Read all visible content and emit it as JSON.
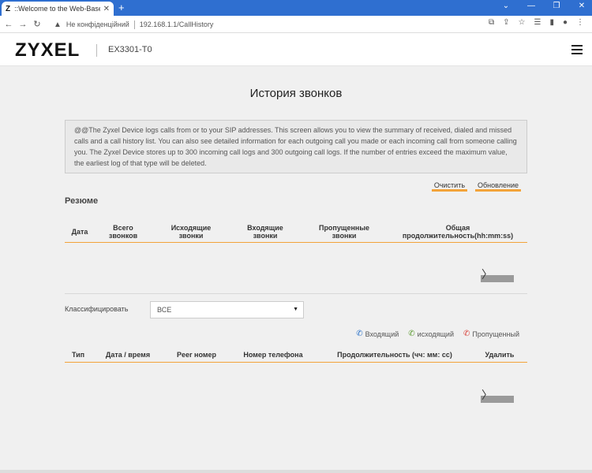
{
  "browser": {
    "tab_favicon": "Z",
    "tab_title": "::Welcome to the Web-Based Co",
    "tab_close": "✕",
    "new_tab": "+",
    "security_text": "Не конфіденційний",
    "url": "192.168.1.1/CallHistory"
  },
  "header": {
    "logo": "ZYXEL",
    "model": "EX3301-T0"
  },
  "page": {
    "title": "История звонков",
    "info": "@@The Zyxel Device logs calls from or to your SIP addresses. This screen allows you to view the summary of received, dialed and missed calls and a call history list. You can also see detailed information for each outgoing call you made or each incoming call from someone calling you. The Zyxel Device stores up to 300 incoming call logs and 300 outgoing call logs. If the number of entries exceed the maximum value, the earliest log of that type will be deleted.",
    "clear_label": "Очистить",
    "refresh_label": "Обновление"
  },
  "summary": {
    "title": "Резюме",
    "columns": [
      "Дата",
      "Всего звонков",
      "Исходящие звонки",
      "Входящие звонки",
      "Пропущенные звонки",
      "Общая продолжительность(hh:mm:ss)"
    ]
  },
  "filter": {
    "label": "Классифицировать",
    "value": "ВСЕ"
  },
  "legend": {
    "incoming": "Входящий",
    "outgoing": "исходящий",
    "missed": "Пропущенный"
  },
  "history": {
    "columns": [
      "Тип",
      "Дата / время",
      "Peer номер",
      "Номер телефона",
      "Продолжительность (чч: мм: сс)",
      "Удалить"
    ]
  },
  "colors": {
    "accent": "#f3a33a",
    "browser_blue": "#2f6fd0",
    "incoming": "#2a72c9",
    "outgoing": "#5a9b2f",
    "missed": "#d9413a"
  }
}
